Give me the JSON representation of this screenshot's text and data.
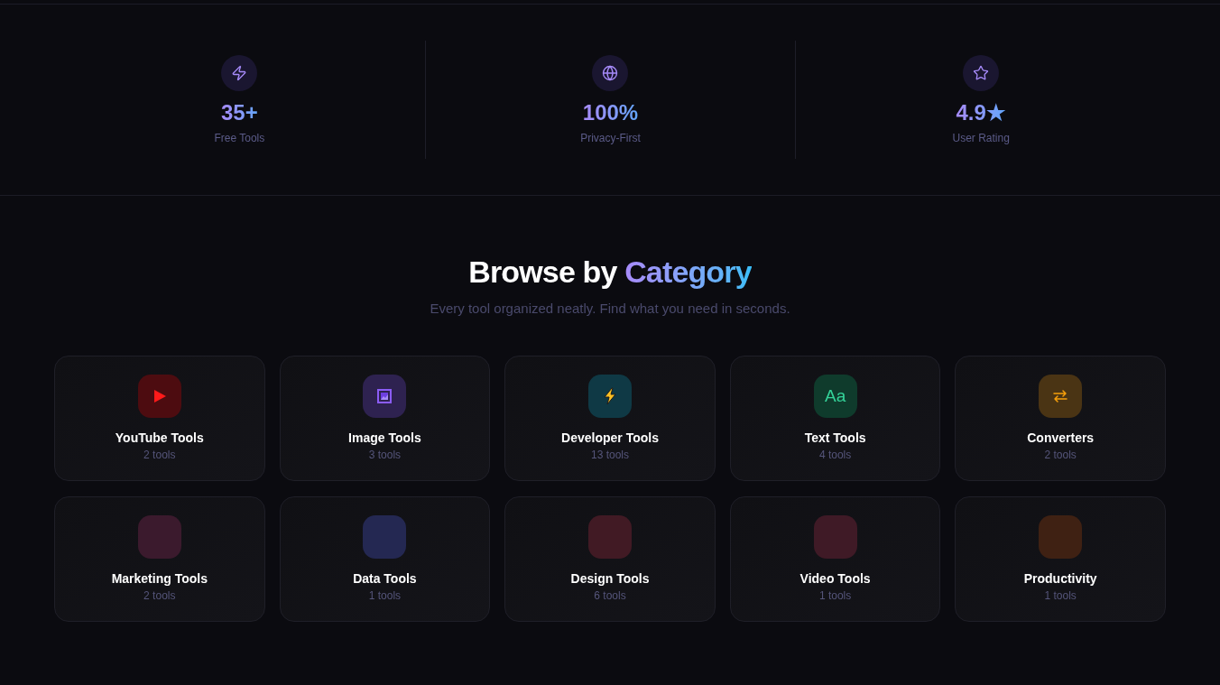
{
  "stats": [
    {
      "kind": "bolt",
      "value": "35+",
      "label": "Free Tools"
    },
    {
      "kind": "globe",
      "value": "100%",
      "label": "Privacy-First"
    },
    {
      "kind": "star",
      "value": "4.9★",
      "label": "User Rating"
    }
  ],
  "categories_section": {
    "heading": "Browse by",
    "heading_highlight": "Category",
    "subtitle": "Every tool organized neatly. Find what you need in seconds."
  },
  "categories": [
    {
      "kind": "play",
      "name": "YouTube Tools",
      "count": "2 tools",
      "color": "#4d0c10"
    },
    {
      "kind": "picture",
      "name": "Image Tools",
      "count": "3 tools",
      "color": "#2e2250"
    },
    {
      "kind": "bolt",
      "name": "Developer Tools",
      "count": "13 tools",
      "color": "#0f3945"
    },
    {
      "kind": "text",
      "icon_text": "Aa",
      "name": "Text Tools",
      "count": "4 tools",
      "color": "#0f3b2c"
    },
    {
      "kind": "swap",
      "name": "Converters",
      "count": "2 tools",
      "color": "#4a3414"
    },
    {
      "kind": "blank",
      "name": "Marketing Tools",
      "count": "2 tools",
      "color": "#3b1a2d"
    },
    {
      "kind": "blank",
      "name": "Data Tools",
      "count": "1 tools",
      "color": "#242852"
    },
    {
      "kind": "blank",
      "name": "Design Tools",
      "count": "6 tools",
      "color": "#411a24"
    },
    {
      "kind": "blank",
      "name": "Video Tools",
      "count": "1 tools",
      "color": "#3f1a26"
    },
    {
      "kind": "blank",
      "name": "Productivity",
      "count": "1 tools",
      "color": "#3f2113"
    }
  ]
}
